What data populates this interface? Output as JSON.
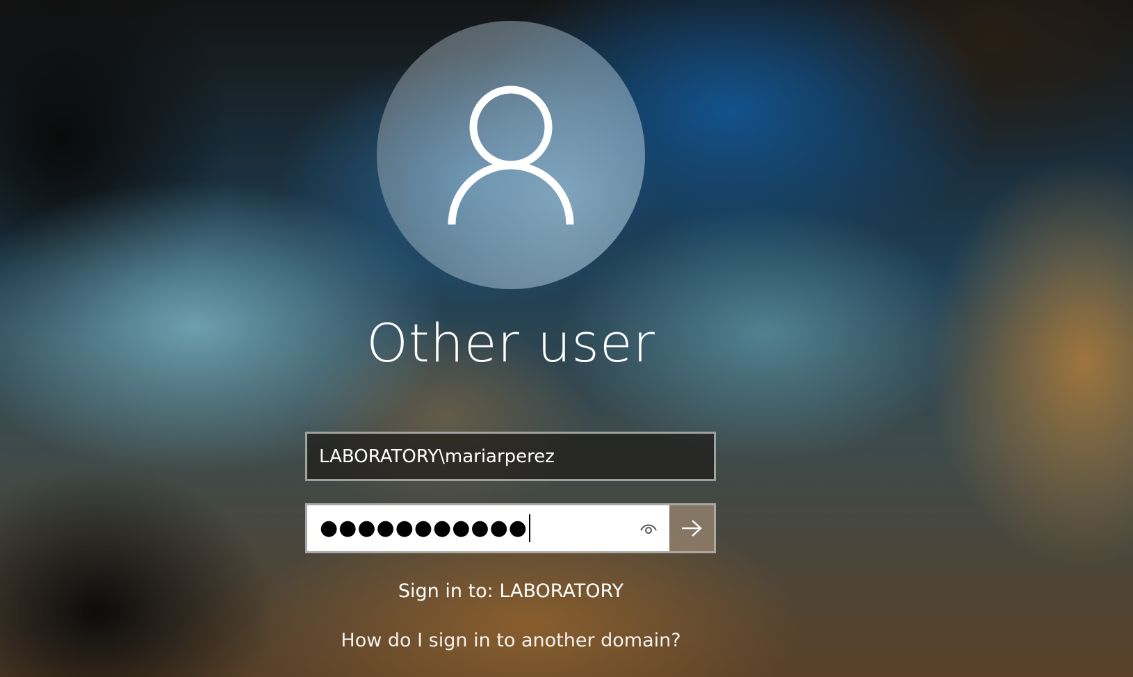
{
  "account": {
    "display_name": "Other user",
    "avatar_icon": "user-silhouette-icon"
  },
  "form": {
    "username_value": "LABORATORY\\mariarperez",
    "password_masked": "●●●●●●●●●●●",
    "reveal_icon": "eye-icon",
    "submit_icon": "arrow-right-icon"
  },
  "domain_info": {
    "sign_in_to": "Sign in to: LABORATORY"
  },
  "links": {
    "other_domain": "How do I sign in to another domain?"
  },
  "colors": {
    "text": "#ffffff",
    "input_bg": "#ffffff",
    "submit_bg": "#96826e"
  }
}
